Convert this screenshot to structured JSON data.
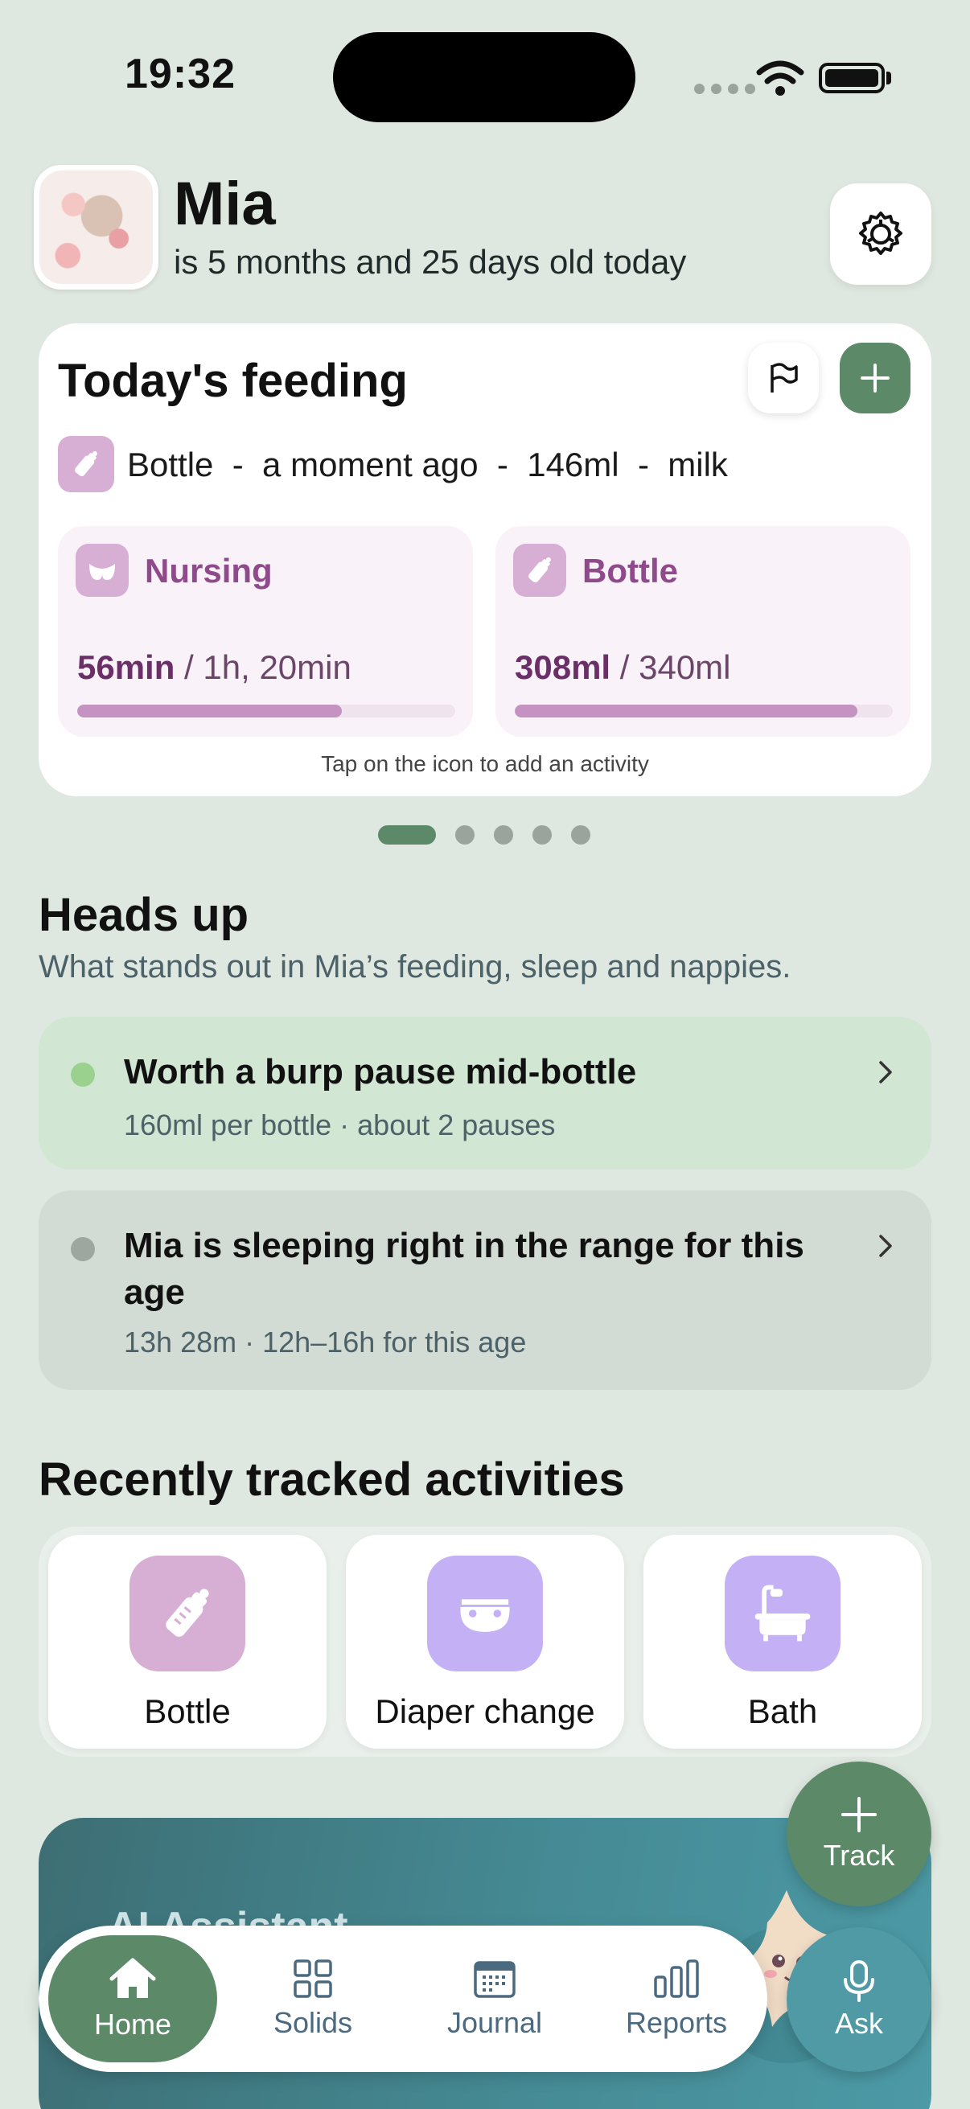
{
  "status_bar": {
    "time": "19:32"
  },
  "header": {
    "name": "Mia",
    "age_text": "is 5 months and 25 days old today"
  },
  "feeding_card": {
    "title": "Today's feeding",
    "last_entry": "Bottle  -  a moment ago  -  146ml  -  milk",
    "nursing": {
      "label": "Nursing",
      "value": "56min",
      "target": " / 1h, 20min",
      "progress": 0.7
    },
    "bottle": {
      "label": "Bottle",
      "value": "308ml",
      "target": " / 340ml",
      "progress": 0.906
    },
    "hint": "Tap on the icon to add an activity"
  },
  "pager": {
    "pages": 5,
    "active": 0
  },
  "heads_up": {
    "title": "Heads up",
    "subtitle": "What stands out in Mia’s feeding, sleep and nappies.",
    "tips": [
      {
        "title": "Worth a burp pause mid-bottle",
        "sub": "160ml per bottle · about 2 pauses",
        "dot_color": "#9bd18f"
      },
      {
        "title": "Mia is sleeping right in the range for this age",
        "sub": "13h 28m · 12h–16h for this age",
        "dot_color": "#9ea6a0"
      }
    ]
  },
  "recent": {
    "title": "Recently tracked activities",
    "items": [
      {
        "label": "Bottle",
        "icon": "bottle-icon",
        "color": "#d7aed4"
      },
      {
        "label": "Diaper change",
        "icon": "diaper-icon",
        "color": "#c4b0f5"
      },
      {
        "label": "Bath",
        "icon": "bathtub-icon",
        "color": "#c4b0f5"
      }
    ]
  },
  "ai_banner": {
    "title": "AI Assistant"
  },
  "fab": {
    "track": "Track",
    "ask": "Ask"
  },
  "tabs": {
    "home": "Home",
    "solids": "Solids",
    "journal": "Journal",
    "reports": "Reports"
  },
  "colors": {
    "accent": "#5c8a68",
    "feeding": "#d7aed4",
    "ask": "#4f9aa4",
    "background": "#dfe8e0"
  }
}
